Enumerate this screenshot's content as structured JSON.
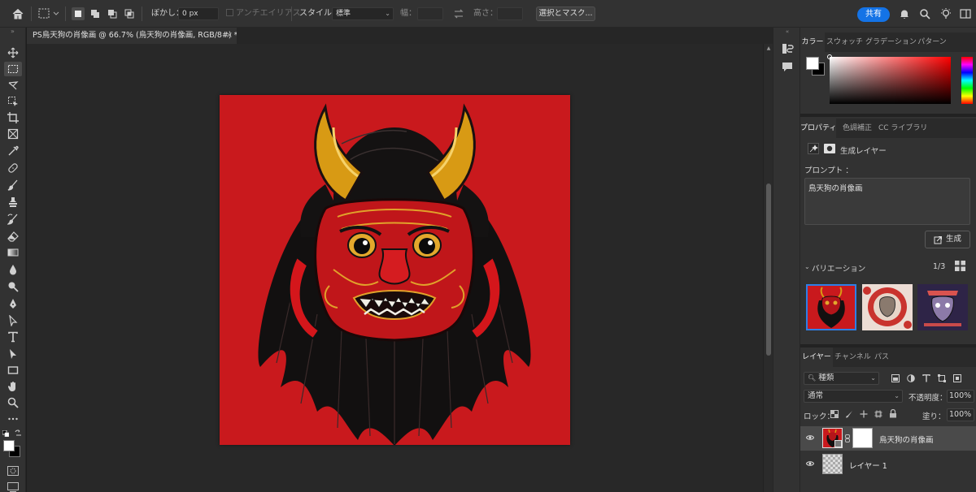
{
  "options_bar": {
    "feather_label": "ぼかし：",
    "feather_value": "0 px",
    "antialias_label": "アンチエイリアス",
    "style_label": "スタイル：",
    "style_value": "標準",
    "width_label": "幅：",
    "height_label": "高さ：",
    "select_mask_label": "選択とマスク...",
    "share_label": "共有"
  },
  "document": {
    "tab_title": "PS烏天狗の肖像画 @ 66.7% (烏天狗の肖像画, RGB/8#) *",
    "close_glyph": "×"
  },
  "color_panel": {
    "tabs": [
      "カラー",
      "スウォッチ",
      "グラデーション",
      "パターン"
    ],
    "foreground": "#ffffff",
    "background": "#000000"
  },
  "properties_panel": {
    "tabs": [
      "プロパティ",
      "色調補正",
      "CC ライブラリ"
    ],
    "layer_type_label": "生成レイヤー",
    "prompt_label": "プロンプト ：",
    "prompt_text": "鳥天狗の肖像画",
    "generate_label": "生成",
    "variations_label": "バリエーション",
    "variations_count": "1/3"
  },
  "layers_panel": {
    "tabs": [
      "レイヤー",
      "チャンネル",
      "パス"
    ],
    "filter_kind": "種類",
    "blend_mode": "通常",
    "opacity_label": "不透明度：",
    "opacity_value": "100%",
    "lock_label": "ロック：",
    "fill_label": "塗り：",
    "fill_value": "100%",
    "layers": [
      {
        "name": "烏天狗の肖像画",
        "visible": true,
        "selected": true
      },
      {
        "name": "レイヤー 1",
        "visible": true,
        "selected": false
      }
    ]
  },
  "colors": {
    "canvas_red": "#c9191d",
    "accent_blue": "#1473e6",
    "ui_dark": "#323232"
  }
}
